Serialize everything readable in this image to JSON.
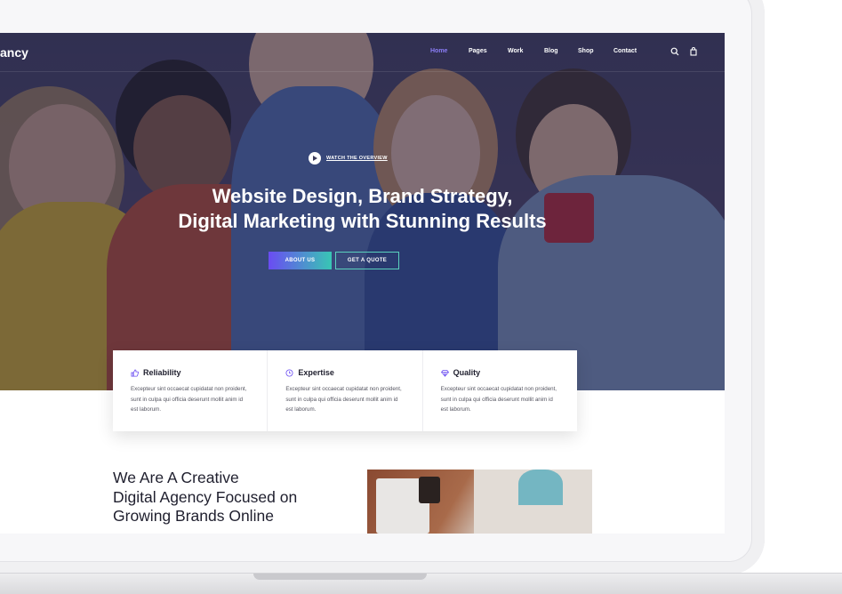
{
  "brand": {
    "logo_text": "ancy"
  },
  "nav": {
    "items": [
      {
        "label": "Home",
        "active": true
      },
      {
        "label": "Pages",
        "active": false
      },
      {
        "label": "Work",
        "active": false
      },
      {
        "label": "Blog",
        "active": false
      },
      {
        "label": "Shop",
        "active": false
      },
      {
        "label": "Contact",
        "active": false
      }
    ],
    "icons": [
      "search-icon",
      "cart-icon"
    ]
  },
  "hero": {
    "watch_label": "WATCH THE OVERVIEW",
    "headline_line1": "Website Design, Brand Strategy,",
    "headline_line2": "Digital Marketing with Stunning Results",
    "primary_button": "ABOUT US",
    "secondary_button": "GET A QUOTE"
  },
  "features": [
    {
      "icon": "thumbs-up-icon",
      "title": "Reliability",
      "text": "Excepteur sint occaecat cupidatat non proident, sunt in culpa qui officia deserunt mollit anim id est laborum."
    },
    {
      "icon": "clock-icon",
      "title": "Expertise",
      "text": "Excepteur sint occaecat cupidatat non proident, sunt in culpa qui officia deserunt mollit anim id est laborum."
    },
    {
      "icon": "diamond-icon",
      "title": "Quality",
      "text": "Excepteur sint occaecat cupidatat non proident, sunt in culpa qui officia deserunt mollit anim id est laborum."
    }
  ],
  "about": {
    "title_line1": "We Are A Creative",
    "title_line2": "Digital Agency Focused on",
    "title_line3": "Growing Brands Online"
  },
  "colors": {
    "accent": "#8b7df6",
    "gradient_start": "#6a4cf2",
    "gradient_end": "#38c6b4",
    "hero_overlay": "#3c3b5a"
  }
}
